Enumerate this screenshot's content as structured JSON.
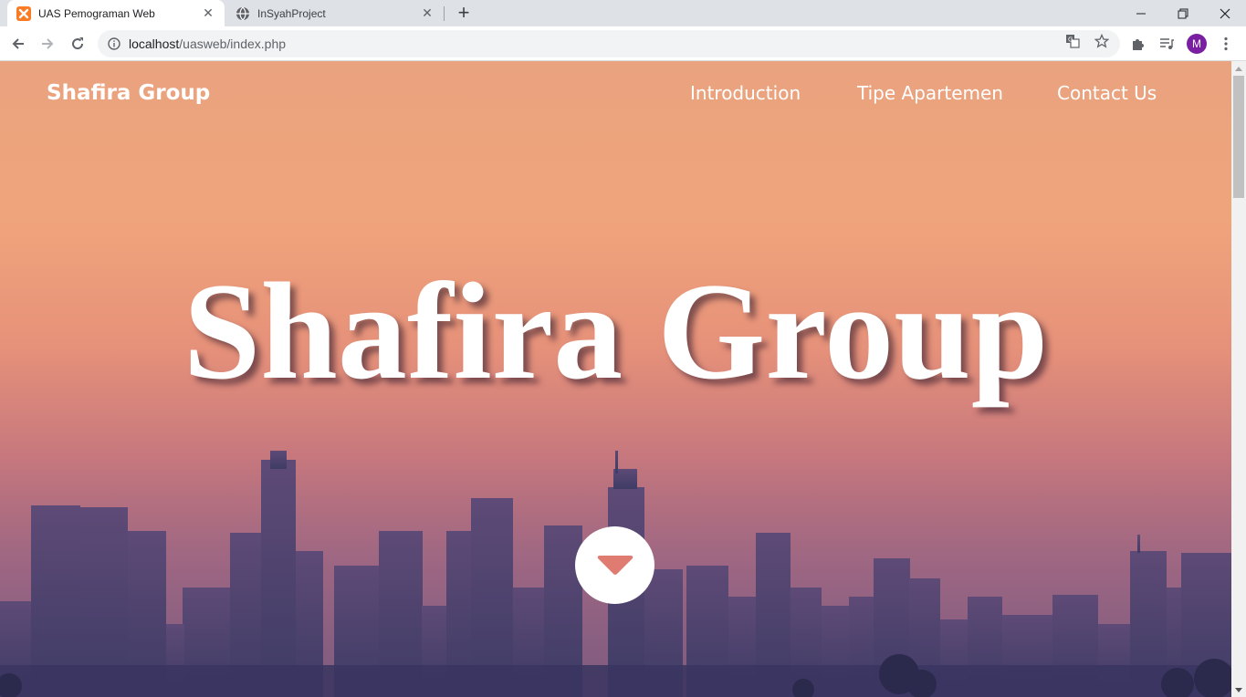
{
  "browser": {
    "tabs": [
      {
        "title": "UAS Pemograman Web",
        "active": true,
        "favicon": "xampp-icon"
      },
      {
        "title": "InSyahProject",
        "active": false,
        "favicon": "globe-icon"
      }
    ],
    "address_host": "localhost",
    "address_path": "/uasweb/index.php",
    "profile_initial": "M",
    "profile_color": "#7b1fa2"
  },
  "site": {
    "brand": "Shafira Group",
    "nav": [
      {
        "label": "Introduction"
      },
      {
        "label": "Tipe Apartemen"
      },
      {
        "label": "Contact Us"
      }
    ],
    "hero_title": "Shafira Group",
    "accent_color": "#e07b72"
  }
}
